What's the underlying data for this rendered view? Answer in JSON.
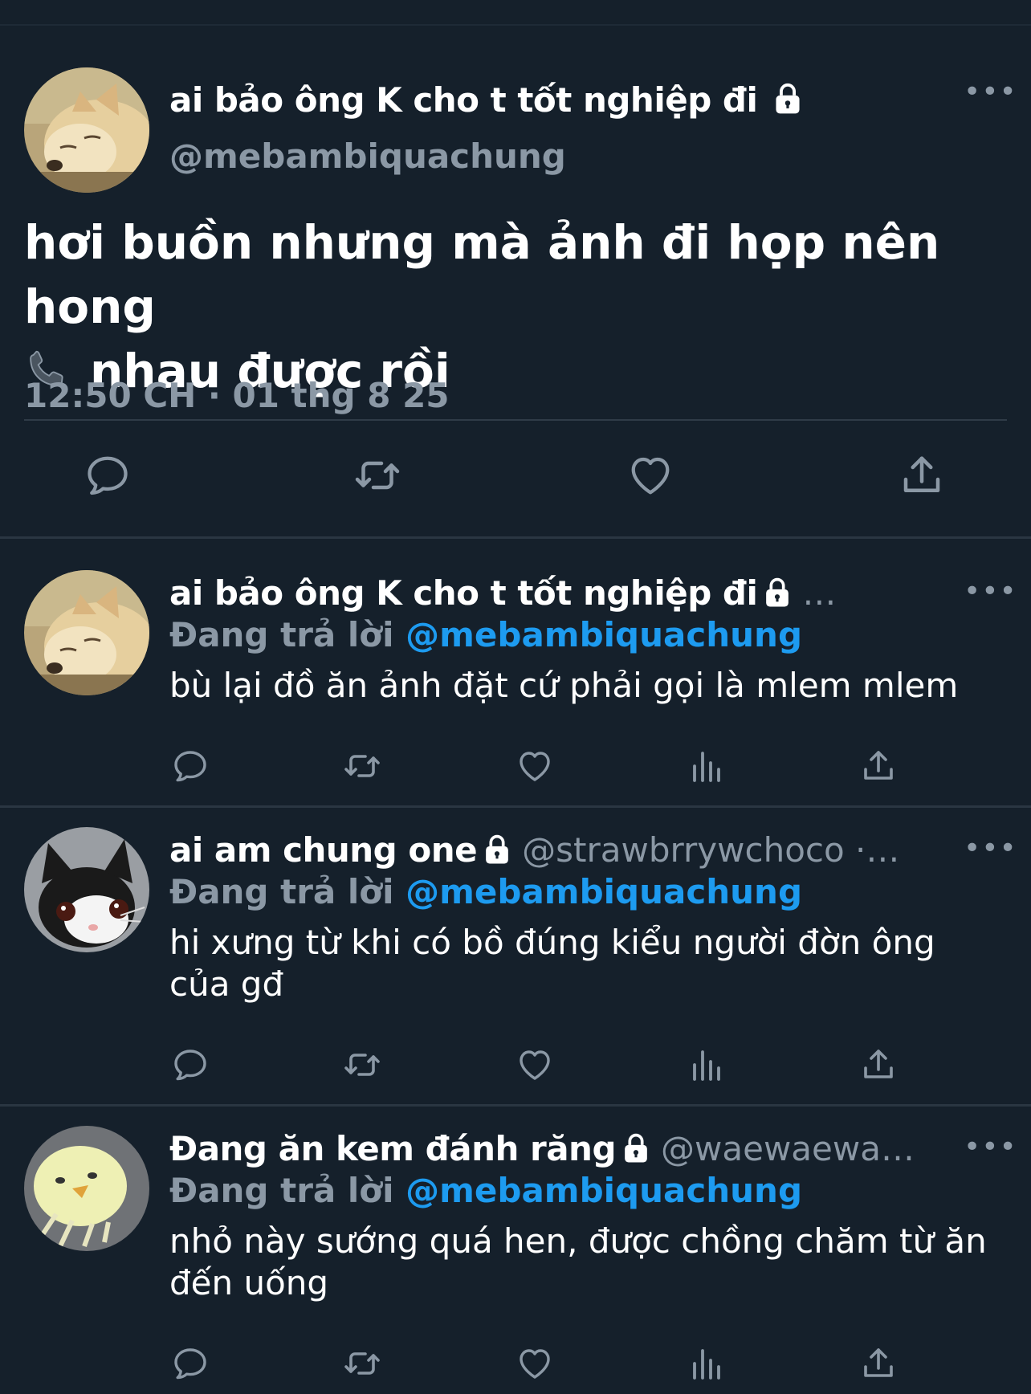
{
  "main": {
    "name": "ai bảo ông K cho t tốt nghiệp đi",
    "handle": "@mebambiquachung",
    "more": "•••",
    "text_line1": "hơi buồn nhưng mà ảnh đi họp nên hong",
    "text_line2": "nhau được rồi",
    "timestamp": "12:50 CH · 01 thg 8 25"
  },
  "replies": [
    {
      "name": "ai bảo ông K cho t tốt nghiệp đi",
      "handle": "…",
      "replying_prefix": "Đang trả lời",
      "replying_to": "@mebambiquachung",
      "text": "bù lại đồ ăn ảnh đặt cứ phải gọi là mlem mlem",
      "more": "•••"
    },
    {
      "name": "ai am chung one",
      "handle": "@strawbrrywchoco ·…",
      "replying_prefix": "Đang trả lời",
      "replying_to": "@mebambiquachung",
      "text": "hi xưng từ khi có bồ đúng kiểu người đờn ông của gđ",
      "more": "•••"
    },
    {
      "name": "Đang ăn kem đánh răng",
      "handle": "@waewaewa…",
      "replying_prefix": "Đang trả lời",
      "replying_to": "@mebambiquachung",
      "text": "nhỏ này sướng quá hen, được chồng chăm từ ăn đến uống",
      "more": "•••"
    }
  ],
  "icons": {
    "lock": "lock-icon",
    "reply": "reply-icon",
    "retweet": "retweet-icon",
    "like": "like-icon",
    "views": "views-icon",
    "share": "share-icon",
    "phone": "phone-icon"
  },
  "colors": {
    "background": "#15202b",
    "text": "#ffffff",
    "secondary": "#8b98a5",
    "accent": "#1d9bf0"
  }
}
